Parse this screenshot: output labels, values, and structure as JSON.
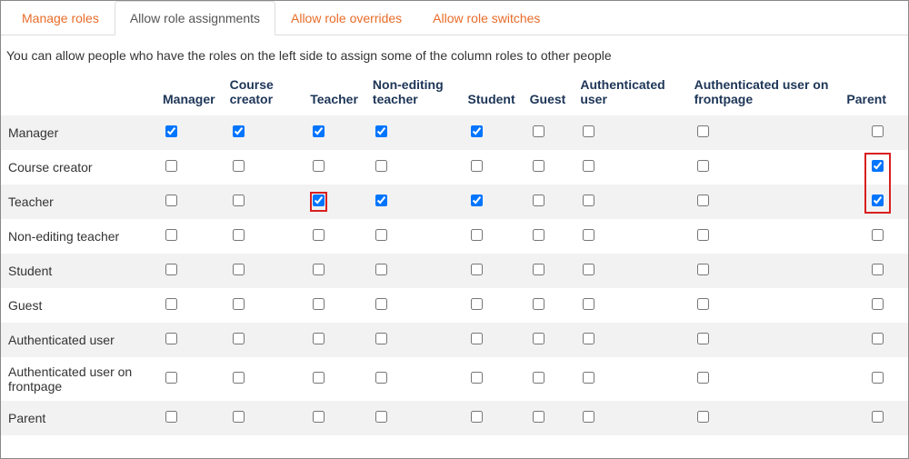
{
  "tabs": [
    {
      "label": "Manage roles",
      "active": false
    },
    {
      "label": "Allow role assignments",
      "active": true
    },
    {
      "label": "Allow role overrides",
      "active": false
    },
    {
      "label": "Allow role switches",
      "active": false
    }
  ],
  "intro": "You can allow people who have the roles on the left side to assign some of the column roles to other people",
  "columns": [
    "Manager",
    "Course creator",
    "Teacher",
    "Non-editing teacher",
    "Student",
    "Guest",
    "Authenticated user",
    "Authenticated user on frontpage",
    "Parent"
  ],
  "rows": [
    {
      "label": "Manager",
      "cells": [
        true,
        true,
        true,
        true,
        true,
        false,
        false,
        false,
        false
      ]
    },
    {
      "label": "Course creator",
      "cells": [
        false,
        false,
        false,
        false,
        false,
        false,
        false,
        false,
        true
      ]
    },
    {
      "label": "Teacher",
      "cells": [
        false,
        false,
        true,
        true,
        true,
        false,
        false,
        false,
        true
      ]
    },
    {
      "label": "Non-editing teacher",
      "cells": [
        false,
        false,
        false,
        false,
        false,
        false,
        false,
        false,
        false
      ]
    },
    {
      "label": "Student",
      "cells": [
        false,
        false,
        false,
        false,
        false,
        false,
        false,
        false,
        false
      ]
    },
    {
      "label": "Guest",
      "cells": [
        false,
        false,
        false,
        false,
        false,
        false,
        false,
        false,
        false
      ]
    },
    {
      "label": "Authenticated user",
      "cells": [
        false,
        false,
        false,
        false,
        false,
        false,
        false,
        false,
        false
      ]
    },
    {
      "label": "Authenticated user on frontpage",
      "cells": [
        false,
        false,
        false,
        false,
        false,
        false,
        false,
        false,
        false
      ]
    },
    {
      "label": "Parent",
      "cells": [
        false,
        false,
        false,
        false,
        false,
        false,
        false,
        false,
        false
      ]
    }
  ],
  "highlights": {
    "single_cells": [
      {
        "row": 2,
        "col": 2
      }
    ],
    "parent_column_box": {
      "row_start": 1,
      "row_end": 2
    }
  }
}
